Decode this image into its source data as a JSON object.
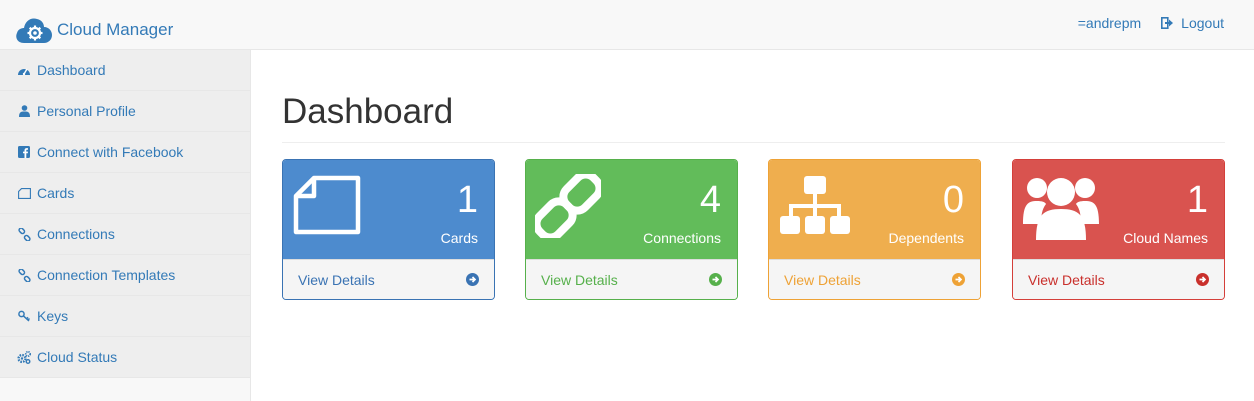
{
  "brand": {
    "name": "Cloud Manager",
    "icon": "cloud-gear-icon"
  },
  "user": {
    "name": "=andrepm",
    "logout_label": "Logout"
  },
  "sidebar": {
    "items": [
      {
        "label": "Dashboard",
        "icon": "dashboard-icon"
      },
      {
        "label": "Personal Profile",
        "icon": "user-icon"
      },
      {
        "label": "Connect with Facebook",
        "icon": "facebook-icon"
      },
      {
        "label": "Cards",
        "icon": "card-icon"
      },
      {
        "label": "Connections",
        "icon": "link-icon"
      },
      {
        "label": "Connection Templates",
        "icon": "link-icon"
      },
      {
        "label": "Keys",
        "icon": "key-icon"
      },
      {
        "label": "Cloud Status",
        "icon": "cogs-icon"
      }
    ]
  },
  "page": {
    "title": "Dashboard"
  },
  "panels": [
    {
      "count": "1",
      "label": "Cards",
      "details": "View Details",
      "color": "#4d8bce",
      "border": "#3a73b3",
      "text": "#3a73b3",
      "icon": "file-icon"
    },
    {
      "count": "4",
      "label": "Connections",
      "details": "View Details",
      "color": "#62bc5a",
      "border": "#56b04b",
      "text": "#56b04b",
      "icon": "chain-icon"
    },
    {
      "count": "0",
      "label": "Dependents",
      "details": "View Details",
      "color": "#efae4e",
      "border": "#eea236",
      "text": "#eea236",
      "icon": "sitemap-icon"
    },
    {
      "count": "1",
      "label": "Cloud Names",
      "details": "View Details",
      "color": "#d9534f",
      "border": "#d43f3a",
      "text": "#c9302c",
      "icon": "users-icon"
    }
  ]
}
